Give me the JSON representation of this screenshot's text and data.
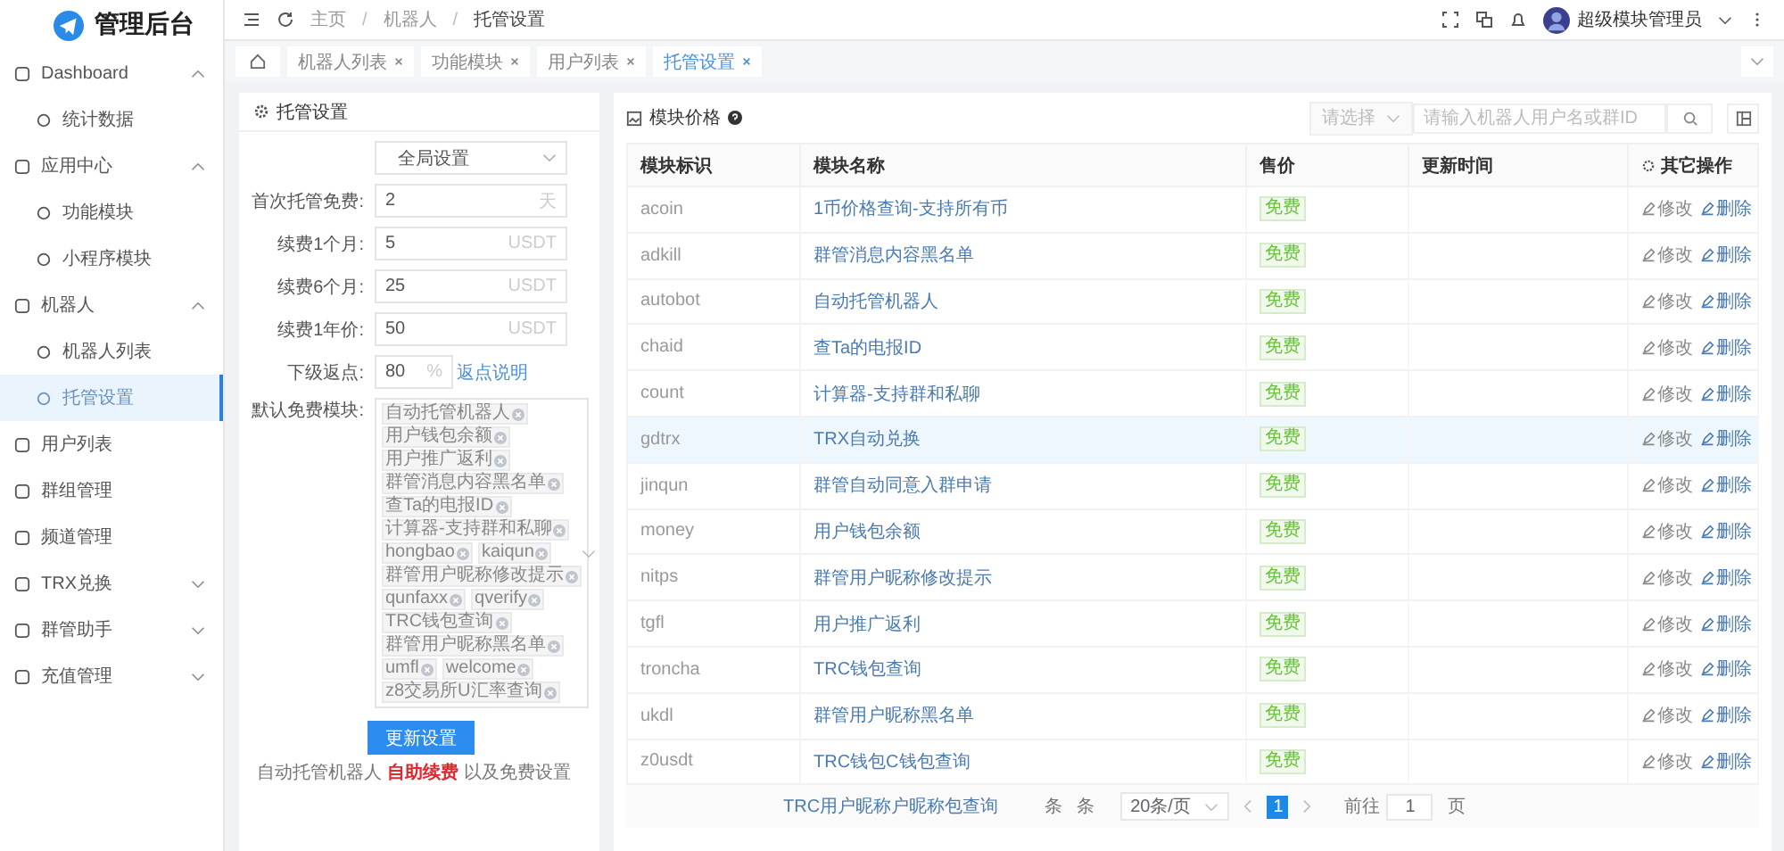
{
  "logo": {
    "title": "管理后台"
  },
  "sidebar": {
    "items": [
      {
        "label": "Dashboard",
        "expanded": true,
        "selected": false,
        "children": [
          {
            "label": "统计数据",
            "selected": false
          }
        ]
      },
      {
        "label": "应用中心",
        "expanded": true,
        "selected": false,
        "children": [
          {
            "label": "功能模块",
            "selected": false
          },
          {
            "label": "小程序模块",
            "selected": false
          }
        ]
      },
      {
        "label": "机器人",
        "expanded": true,
        "selected": false,
        "children": [
          {
            "label": "机器人列表",
            "selected": false
          },
          {
            "label": "托管设置",
            "selected": true
          }
        ]
      },
      {
        "label": "用户列表",
        "selected": false
      },
      {
        "label": "群组管理",
        "selected": false
      },
      {
        "label": "频道管理",
        "selected": false
      },
      {
        "label": "TRX兑换",
        "expanded": false,
        "selected": false
      },
      {
        "label": "群管助手",
        "expanded": false,
        "selected": false
      },
      {
        "label": "充值管理",
        "expanded": false,
        "selected": false
      }
    ]
  },
  "header": {
    "breadcrumb": [
      {
        "label": "主页"
      },
      {
        "sep": "/",
        "label": "机器人"
      },
      {
        "sep": "/",
        "label": "托管设置"
      }
    ],
    "user": "超级模块管理员"
  },
  "tabs": [
    {
      "label": "机器人列表",
      "selected": false
    },
    {
      "label": "功能模块",
      "selected": false
    },
    {
      "label": "用户列表",
      "selected": false
    },
    {
      "label": "托管设置",
      "selected": true
    }
  ],
  "settings": {
    "title": "托管设置",
    "scope": "全局设置",
    "fields": [
      {
        "label": "首次托管免费:",
        "value": "2",
        "suffix": "天"
      },
      {
        "label": "续费1个月:",
        "value": "5",
        "suffix": "USDT"
      },
      {
        "label": "续费6个月:",
        "value": "25",
        "suffix": "USDT"
      },
      {
        "label": "续费1年价:",
        "value": "50",
        "suffix": "USDT"
      }
    ],
    "rebate": {
      "label": "下级返点:",
      "value": "80",
      "suffix": "%",
      "link": "返点说明"
    },
    "free_modules": {
      "label": "默认免费模块:",
      "tags": [
        "自动托管机器人",
        "用户钱包余额",
        "用户推广返利",
        "群管消息内容黑名单",
        "查Ta的电报ID",
        "计算器-支持群和私聊",
        "hongbao",
        "kaiqun",
        "群管用户昵称修改提示",
        "qunfaxx",
        "qverify",
        "TRC钱包查询",
        "群管用户昵称黑名单",
        "umfl",
        "welcome",
        "z8交易所U汇率查询"
      ]
    },
    "button": "更新设置",
    "note": "自动托管机器人 **自助续费** 以及免费设置"
  },
  "prices": {
    "title": "模块价格",
    "filter_placeholder": "请选择",
    "search_placeholder": "请输入机器人用户名或群ID",
    "columns": [
      "模块标识",
      "模块名称",
      "售价",
      "更新时间",
      "其它操作"
    ],
    "rows": [
      {
        "id": "acoin",
        "name": "1币价格查询-支持所有币",
        "price": "免费",
        "selected": false,
        "actions": [
          "修改",
          "删除"
        ]
      },
      {
        "id": "adkill",
        "name": "群管消息内容黑名单",
        "price": "免费",
        "selected": false,
        "actions": [
          "修改",
          "删除"
        ]
      },
      {
        "id": "autobot",
        "name": "自动托管机器人",
        "price": "免费",
        "selected": false,
        "actions": [
          "修改",
          "删除"
        ]
      },
      {
        "id": "chaid",
        "name": "查Ta的电报ID",
        "price": "免费",
        "selected": false,
        "actions": [
          "修改",
          "删除"
        ]
      },
      {
        "id": "count",
        "name": "计算器-支持群和私聊",
        "price": "免费",
        "selected": false,
        "actions": [
          "修改",
          "删除"
        ]
      },
      {
        "id": "gdtrx",
        "name": "TRX自动兑换",
        "price": "免费",
        "selected": true,
        "actions": [
          "修改",
          "删除"
        ]
      },
      {
        "id": "jinqun",
        "name": "群管自动同意入群申请",
        "price": "免费",
        "selected": false,
        "actions": [
          "修改",
          "删除"
        ]
      },
      {
        "id": "money",
        "name": "用户钱包余额",
        "price": "免费",
        "selected": false,
        "actions": [
          "修改",
          "删除"
        ]
      },
      {
        "id": "nitps",
        "name": "群管用户昵称修改提示",
        "price": "免费",
        "selected": false,
        "actions": [
          "修改",
          "删除"
        ]
      },
      {
        "id": "tgfl",
        "name": "用户推广返利",
        "price": "免费",
        "selected": false,
        "actions": [
          "修改",
          "删除"
        ]
      },
      {
        "id": "troncha",
        "name": "TRC钱包查询",
        "price": "免费",
        "selected": false,
        "actions": [
          "修改",
          "删除"
        ]
      },
      {
        "id": "ukdl",
        "name": "群管用户昵称黑名单",
        "price": "免费",
        "selected": false,
        "actions": [
          "修改",
          "删除"
        ]
      },
      {
        "id": "z0usdt",
        "name": "TRC钱包C钱包查询",
        "price": "免费",
        "selected": false,
        "actions": [
          "修改",
          "删除"
        ]
      }
    ],
    "overflow_name": "TRC用户昵称户昵称包查询",
    "pagination": {
      "total_1": "条",
      "total_2": "条",
      "page_size": "20条/页",
      "pages": [
        {
          "label": "1",
          "selected": true
        }
      ],
      "goto": "前往",
      "goto_value": "1",
      "page_suffix": "页"
    }
  }
}
